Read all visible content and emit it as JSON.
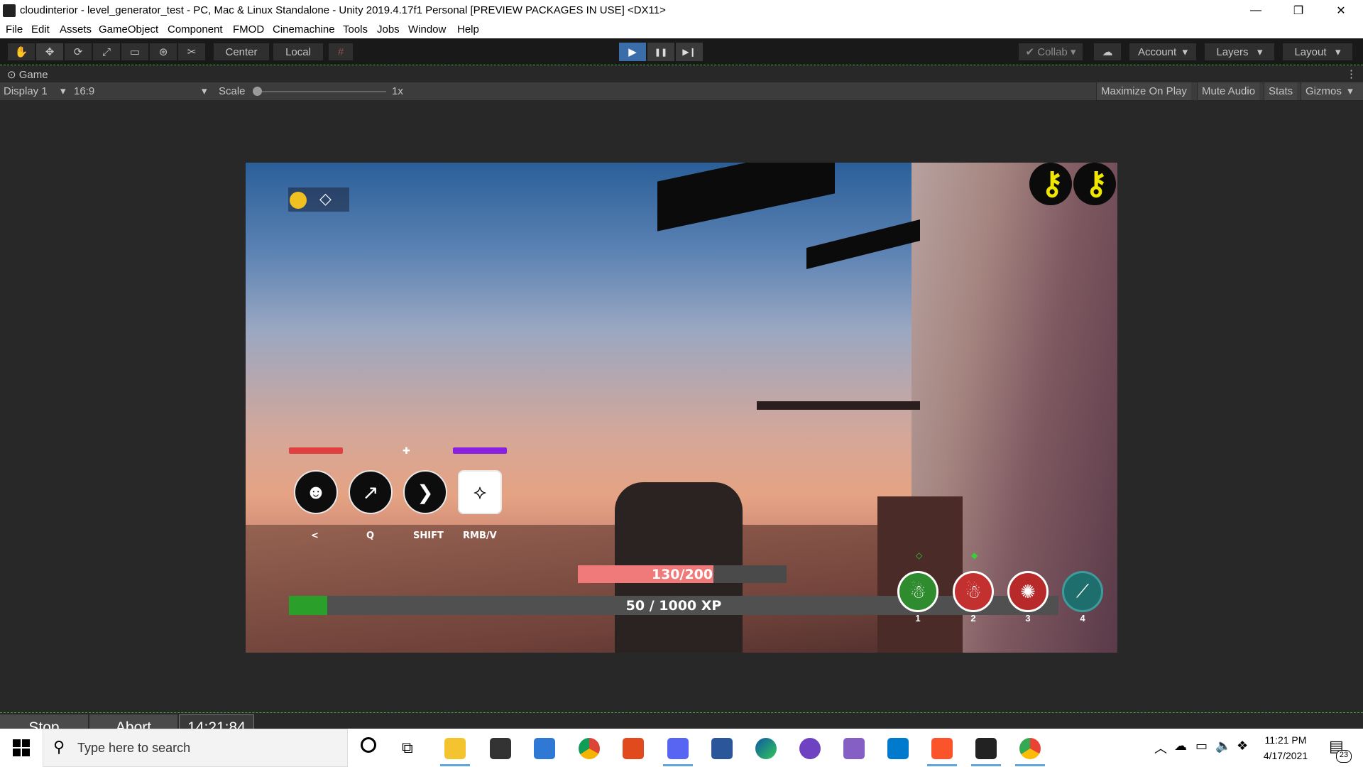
{
  "window": {
    "title": "cloudinterior - level_generator_test - PC, Mac & Linux Standalone - Unity 2019.4.17f1 Personal [PREVIEW PACKAGES IN USE] <DX11>",
    "minimize_glyph": "—",
    "maximize_glyph": "❐",
    "close_glyph": "✕"
  },
  "menu": [
    "File",
    "Edit",
    "Assets",
    "GameObject",
    "Component",
    "FMOD",
    "Cinemachine",
    "Tools",
    "Jobs",
    "Window",
    "Help"
  ],
  "toolbar": {
    "tools": [
      {
        "name": "hand-tool",
        "glyph": "✋"
      },
      {
        "name": "move-tool",
        "glyph": "✥"
      },
      {
        "name": "rotate-tool",
        "glyph": "⟳"
      },
      {
        "name": "scale-tool",
        "glyph": "⤢"
      },
      {
        "name": "rect-tool",
        "glyph": "▭"
      },
      {
        "name": "transform-tool",
        "glyph": "⊛"
      },
      {
        "name": "custom-tool",
        "glyph": "✂"
      }
    ],
    "pivot_label": "Center",
    "space_label": "Local",
    "snap_glyph": "#",
    "play_glyph": "▶",
    "pause_glyph": "❚❚",
    "step_glyph": "▶❙",
    "collab_label": "Collab",
    "account_label": "Account",
    "layers_label": "Layers",
    "layout_label": "Layout"
  },
  "game_tab": {
    "label": "Game",
    "display": "Display 1",
    "aspect": "16:9",
    "scale_label": "Scale",
    "scale_value": "1x",
    "maximize_on_play": "Maximize On Play",
    "mute_audio": "Mute Audio",
    "stats": "Stats",
    "gizmos": "Gizmos"
  },
  "hud": {
    "abilities": [
      {
        "name": "lion-ability",
        "glyph": "☻",
        "key": "<"
      },
      {
        "name": "grapple-ability",
        "glyph": "↗",
        "key": "Q"
      },
      {
        "name": "dash-ability",
        "glyph": "❯",
        "key": "SHIFT"
      },
      {
        "name": "wings-ability",
        "glyph": "⟡",
        "key": "RMB/V"
      }
    ],
    "health_text": "130/200",
    "health_fraction": 0.65,
    "xp_text": "50 / 1000 XP",
    "xp_fraction": 0.05,
    "crosshair_glyph": "✚",
    "slots": [
      {
        "name": "slot-1",
        "num": "1",
        "color": "#2e8b2e",
        "glyph": "☃"
      },
      {
        "name": "slot-2",
        "num": "2",
        "color": "#c23030",
        "glyph": "☃"
      },
      {
        "name": "slot-3",
        "num": "3",
        "color": "#b82a2a",
        "glyph": "✺"
      },
      {
        "name": "slot-4",
        "num": "4",
        "color": "#1e6e6e",
        "glyph": "⟋"
      }
    ]
  },
  "play_status": {
    "stop": "Stop",
    "abort": "Abort",
    "timer": "14:21:84"
  },
  "taskbar": {
    "search_placeholder": "Type here to search",
    "time": "11:21 PM",
    "date": "4/17/2021",
    "notifications": "23"
  }
}
